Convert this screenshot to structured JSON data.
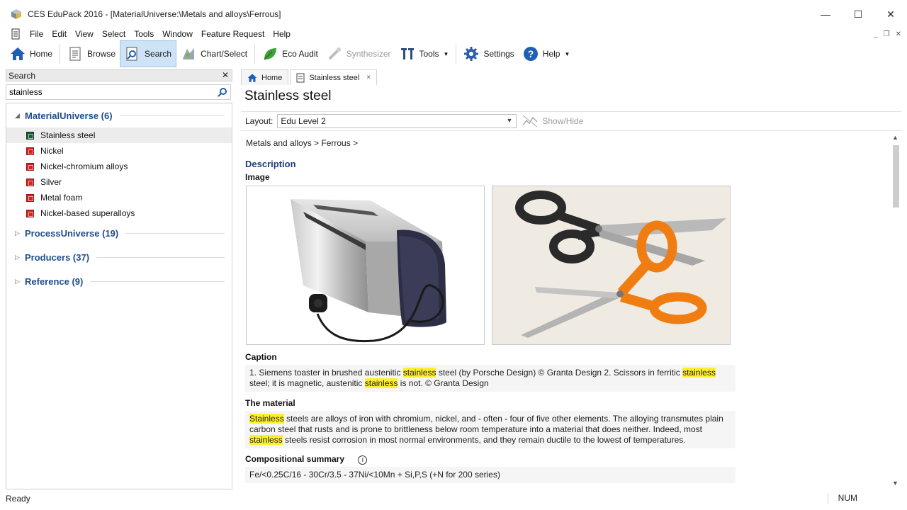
{
  "window": {
    "title": "CES EduPack 2016 - [MaterialUniverse:\\Metals and alloys\\Ferrous]",
    "minimize": "—",
    "maximize": "☐",
    "close": "✕"
  },
  "menu": [
    "File",
    "Edit",
    "View",
    "Select",
    "Tools",
    "Window",
    "Feature Request",
    "Help"
  ],
  "mdi": {
    "minimize": "_",
    "restore": "❐",
    "close": "✕"
  },
  "toolbar": {
    "home": "Home",
    "browse": "Browse",
    "search": "Search",
    "chart_select": "Chart/Select",
    "eco_audit": "Eco Audit",
    "synthesizer": "Synthesizer",
    "tools": "Tools",
    "settings": "Settings",
    "help": "Help"
  },
  "search_panel": {
    "header": "Search",
    "close": "✕",
    "query": "stainless",
    "groups": [
      {
        "label": "MaterialUniverse (6)",
        "expanded": true,
        "items": [
          "Stainless steel",
          "Nickel",
          "Nickel-chromium alloys",
          "Silver",
          "Metal foam",
          "Nickel-based superalloys"
        ]
      },
      {
        "label": "ProcessUniverse (19)",
        "expanded": false
      },
      {
        "label": "Producers (37)",
        "expanded": false
      },
      {
        "label": "Reference (9)",
        "expanded": false
      }
    ],
    "selected_item": "Stainless steel"
  },
  "tabs": [
    {
      "label": "Home",
      "icon": "home-icon"
    },
    {
      "label": "Stainless steel",
      "icon": "document-icon",
      "close": "×"
    }
  ],
  "record": {
    "title": "Stainless steel",
    "layout_label": "Layout:",
    "layout_value": "Edu Level 2",
    "show_hide": "Show/Hide",
    "breadcrumb": "Metals and alloys  >  Ferrous  >",
    "description_heading": "Description",
    "image_label": "Image",
    "caption_label": "Caption",
    "caption": {
      "p1": "1. Siemens toaster in brushed austenitic ",
      "h1": "stainless",
      "p2": " steel (by Porsche Design) © Granta Design  2. Scissors in ferritic ",
      "h2": "stainless",
      "p3": " steel; it is magnetic, austenitic ",
      "h3": "stainless",
      "p4": " is not. © Granta Design"
    },
    "material_label": "The material",
    "material": {
      "h1": "Stainless",
      "p1": " steels are alloys of iron with chromium, nickel, and - often - four of five other elements. The alloying transmutes plain carbon steel that rusts and is prone to brittleness below room temperature into a material that does neither. Indeed, most ",
      "h2": "stainless",
      "p2": " steels resist corrosion in most normal environments, and they remain ductile to the lowest of temperatures."
    },
    "composition_label": "Compositional summary",
    "composition_info": "i",
    "composition": "Fe/<0.25C/16 - 30Cr/3.5 - 37Ni/<10Mn + Si,P,S (+N for 200 series)"
  },
  "status": {
    "left": "Ready",
    "num": "NUM"
  },
  "colors": {
    "highlight": "#ffef2e",
    "heading_blue": "#1f3f7a",
    "active_tool": "#cfe3f7"
  }
}
